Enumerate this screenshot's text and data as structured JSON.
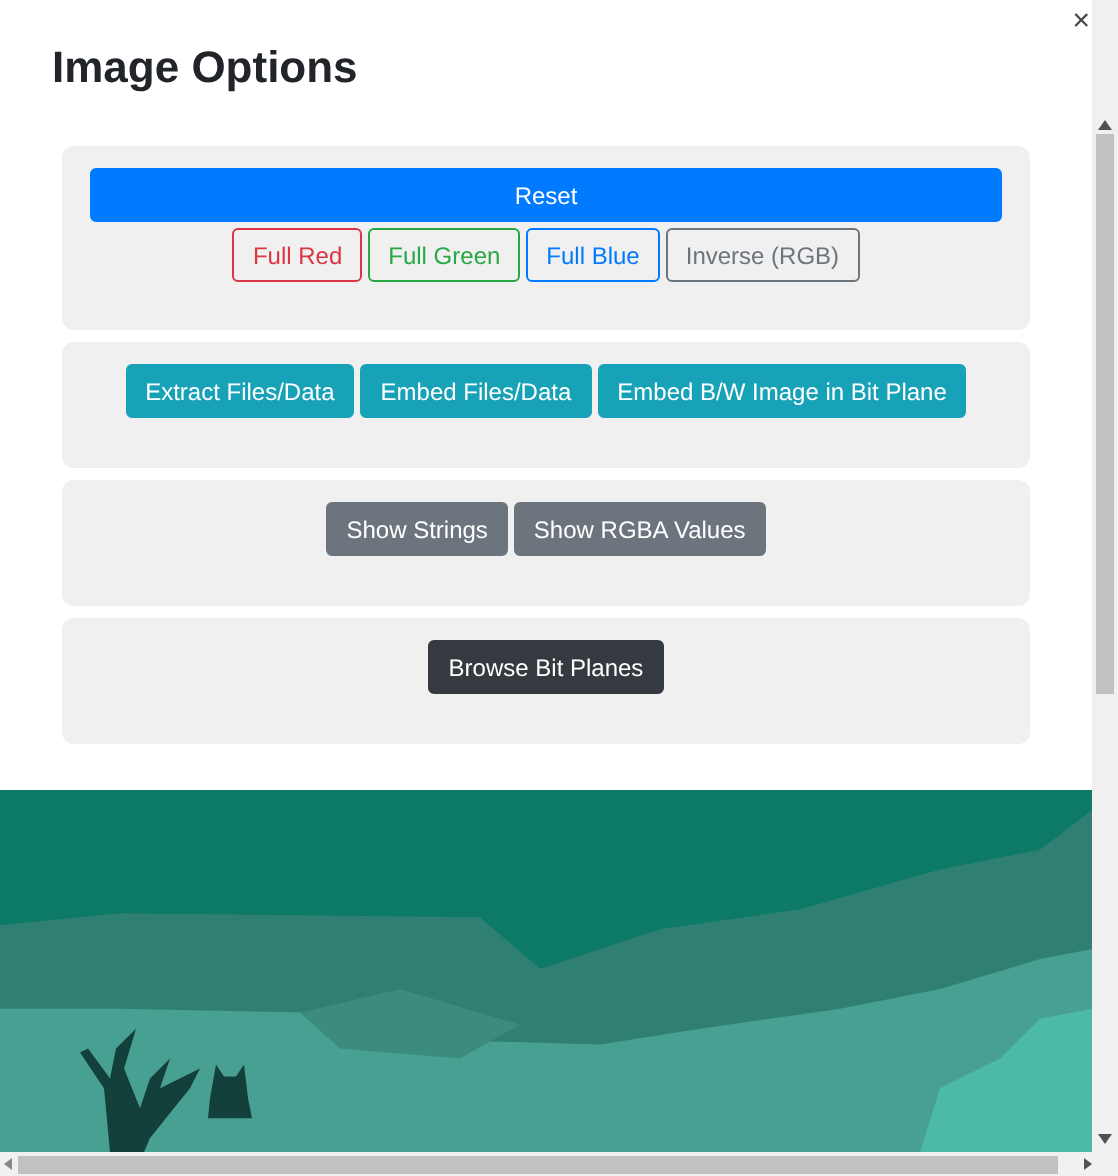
{
  "dialog": {
    "title": "Image Options",
    "close": "×"
  },
  "groups": [
    {
      "buttons": [
        {
          "label": "Reset"
        },
        {
          "label": "Full Red"
        },
        {
          "label": "Full Green"
        },
        {
          "label": "Full Blue"
        },
        {
          "label": "Inverse (RGB)"
        }
      ]
    },
    {
      "buttons": [
        {
          "label": "Extract Files/Data"
        },
        {
          "label": "Embed Files/Data"
        },
        {
          "label": "Embed B/W Image in Bit Plane"
        }
      ]
    },
    {
      "buttons": [
        {
          "label": "Show Strings"
        },
        {
          "label": "Show RGBA Values"
        }
      ]
    },
    {
      "buttons": [
        {
          "label": "Browse Bit Planes"
        }
      ]
    }
  ]
}
